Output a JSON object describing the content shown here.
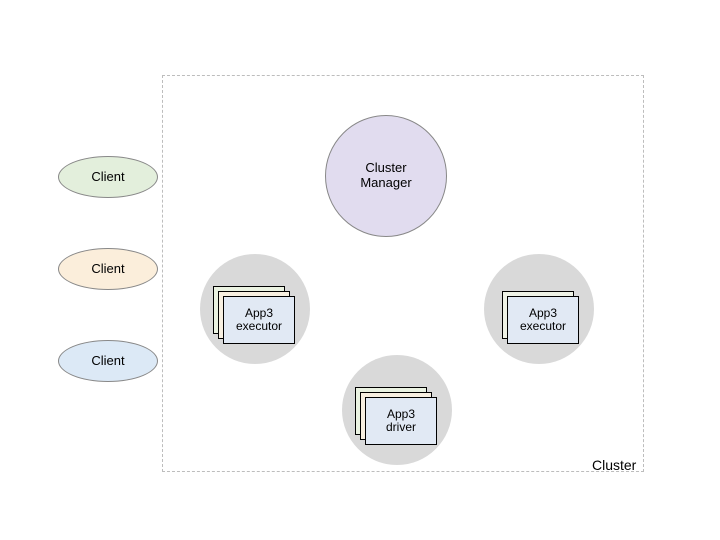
{
  "clients": {
    "c1": "Client",
    "c2": "Client",
    "c3": "Client"
  },
  "clusterManager": "Cluster\nManager",
  "workers": {
    "w1": {
      "label": "App3\nexecutor"
    },
    "w2": {
      "label": "App3\nexecutor"
    },
    "w3": {
      "label": "App3\ndriver"
    }
  },
  "clusterLabel": "Cluster",
  "colors": {
    "client1": "#e3efdc",
    "client2": "#fbeedb",
    "client3": "#dce9f6",
    "clusterManager": "#e1dcef",
    "workerNode": "#d9d9d9",
    "tileTop": "#e1e9f4",
    "tileMid": "#f7efe0",
    "tileBack": "#eaf2e1",
    "clusterBorder": "#bdbdbd"
  }
}
